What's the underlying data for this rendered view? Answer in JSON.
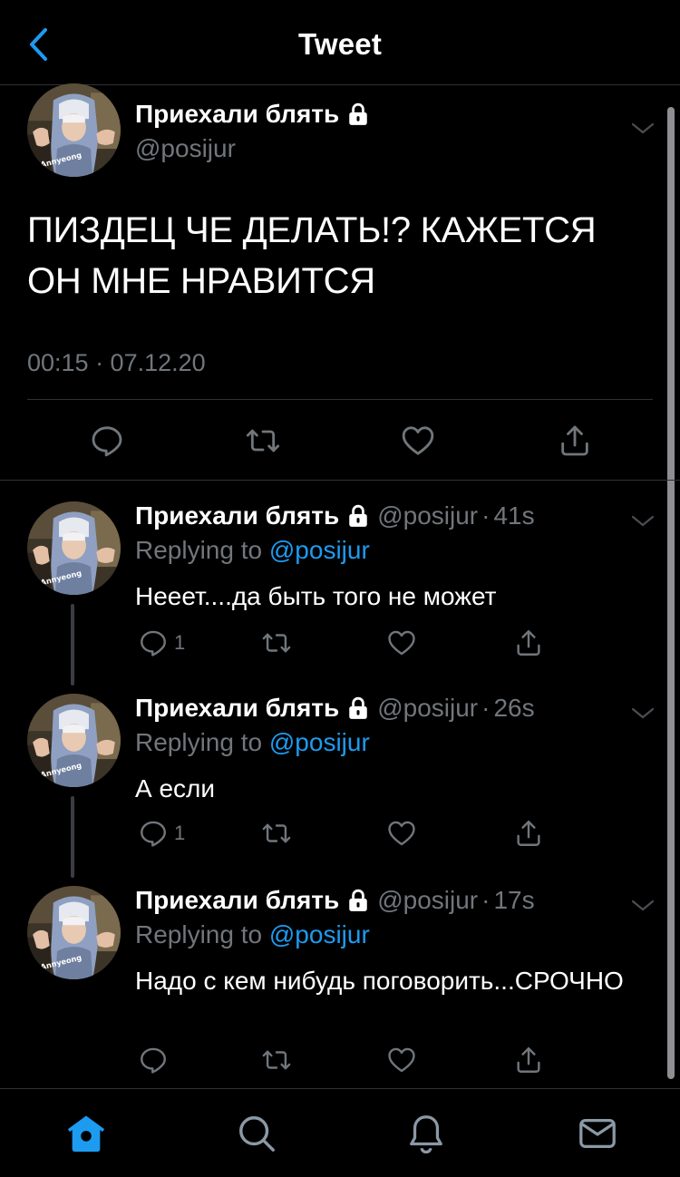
{
  "header": {
    "title": "Tweet",
    "back_icon": "chevron-left-icon"
  },
  "colors": {
    "background": "#000000",
    "accent": "#1d9bf0",
    "secondary_text": "#71767b",
    "divider": "#2f3336"
  },
  "main_tweet": {
    "display_name": "Приехали блять",
    "handle": "@posijur",
    "protected": true,
    "avatar_text": "Annyeong",
    "text": "ПИЗДЕЦ ЧЕ ДЕЛАТЬ!? КАЖЕТСЯ ОН МНЕ НРАВИТСЯ",
    "timestamp": "00:15 · 07.12.20",
    "actions": [
      "reply-icon",
      "retweet-icon",
      "like-icon",
      "share-icon"
    ]
  },
  "replies": [
    {
      "display_name": "Приехали блять",
      "handle": "@posijur",
      "separator": "·",
      "time": "41s",
      "replying_prefix": "Replying to",
      "replying_to": "@posijur",
      "text": "Нееет....да быть того не может",
      "reply_count": "1",
      "avatar_text": "Annyeong"
    },
    {
      "display_name": "Приехали блять",
      "handle": "@posijur",
      "separator": "·",
      "time": "26s",
      "replying_prefix": "Replying to",
      "replying_to": "@posijur",
      "text": "А если",
      "reply_count": "1",
      "avatar_text": "Annyeong"
    },
    {
      "display_name": "Приехали блять",
      "handle": "@posijur",
      "separator": "·",
      "time": "17s",
      "replying_prefix": "Replying to",
      "replying_to": "@posijur",
      "text": "Надо с кем нибудь поговорить...СРОЧНО",
      "reply_count": "",
      "avatar_text": "Annyeong"
    }
  ],
  "tabbar": {
    "tabs": [
      "home-icon",
      "search-icon",
      "notifications-icon",
      "messages-icon"
    ],
    "active": "home-icon"
  }
}
